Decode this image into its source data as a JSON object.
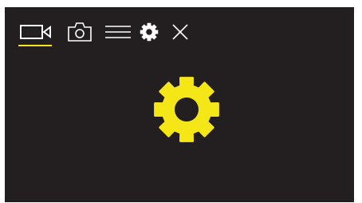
{
  "theme": {
    "background": "#231f20",
    "icon_color": "#ffffff",
    "accent": "#f5e617"
  },
  "toolbar": {
    "items": [
      {
        "icon": "video-camera-icon",
        "active": true
      },
      {
        "icon": "photo-camera-icon",
        "active": false
      },
      {
        "icon": "menu-icon",
        "active": false
      },
      {
        "icon": "settings-gear-icon",
        "active": false
      },
      {
        "icon": "close-icon",
        "active": false
      }
    ]
  },
  "main": {
    "icon": "settings-gear-icon"
  }
}
